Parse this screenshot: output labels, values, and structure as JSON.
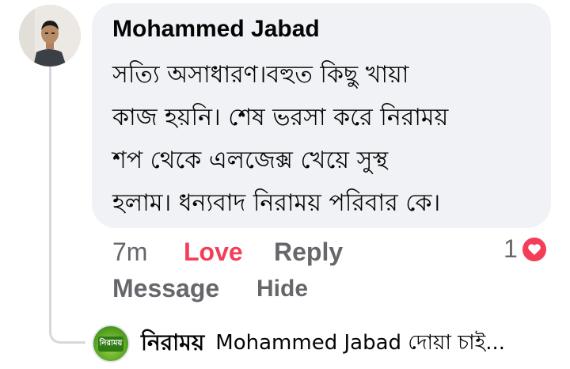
{
  "comment": {
    "author": "Mohammed Jabad",
    "text_lines": [
      "সত্যি অসাধারণ।বহুত কিছু খায়া",
      "কাজ হয়নি। শেষ ভরসা করে নিরাময়",
      "শপ থেকে এলজেক্স খেয়ে সুস্থ",
      "হলাম। ধন্যবাদ নিরাময় পরিবার কে।"
    ]
  },
  "actions": {
    "time": "7m",
    "love": "Love",
    "reply": "Reply",
    "message": "Message",
    "hide": "Hide"
  },
  "reactions": {
    "count": "1",
    "icon": "heart-icon",
    "color": "#f33e58"
  },
  "reply": {
    "author": "নিরাময়",
    "text": "Mohammed Jabad দোয়া চাই...",
    "avatar_logo_text": "নিরাময়"
  }
}
